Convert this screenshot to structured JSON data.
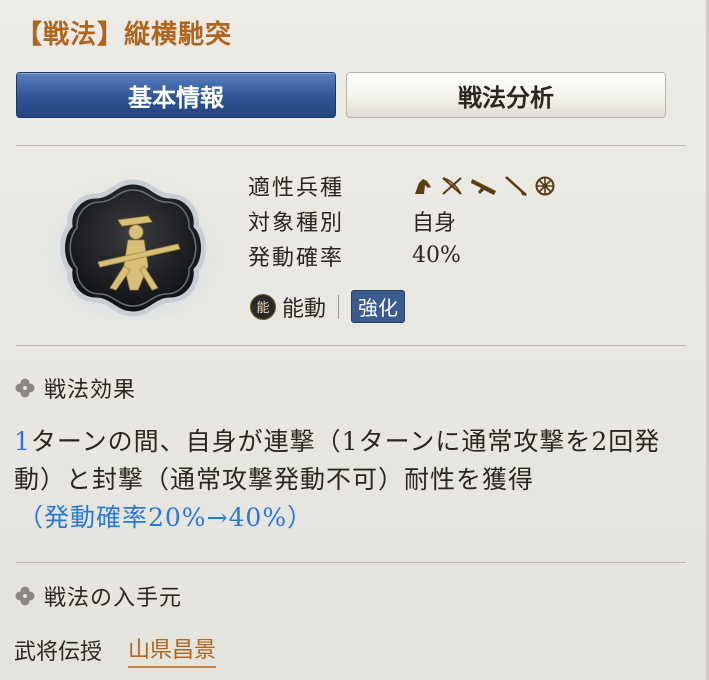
{
  "title": "【戦法】縦横馳突",
  "tabs": [
    {
      "label": "基本情報",
      "active": true
    },
    {
      "label": "戦法分析",
      "active": false
    }
  ],
  "info": {
    "troop_label": "適性兵種",
    "troop_icons": [
      "cavalry-icon",
      "bow-icon",
      "gun-icon",
      "spear-icon",
      "shield-icon"
    ],
    "target_label": "対象種別",
    "target_value": "自身",
    "rate_label": "発動確率",
    "rate_value": "40%"
  },
  "ability": {
    "badge": "能",
    "type": "能動",
    "tag": "強化"
  },
  "effect": {
    "heading": "戦法効果",
    "num": "1",
    "text": "ターンの間、自身が連撃（1ターンに通常攻撃を2回発動）と封撃（通常攻撃発動不可）耐性を獲得",
    "note": "（発動確率20%→40%）"
  },
  "source": {
    "heading": "戦法の入手元",
    "label": "武将伝授",
    "link": "山県昌景"
  },
  "colors": {
    "title": "#b0651d",
    "tab_active": "#2f5597",
    "note": "#2a78d8",
    "link": "#b0651d"
  }
}
